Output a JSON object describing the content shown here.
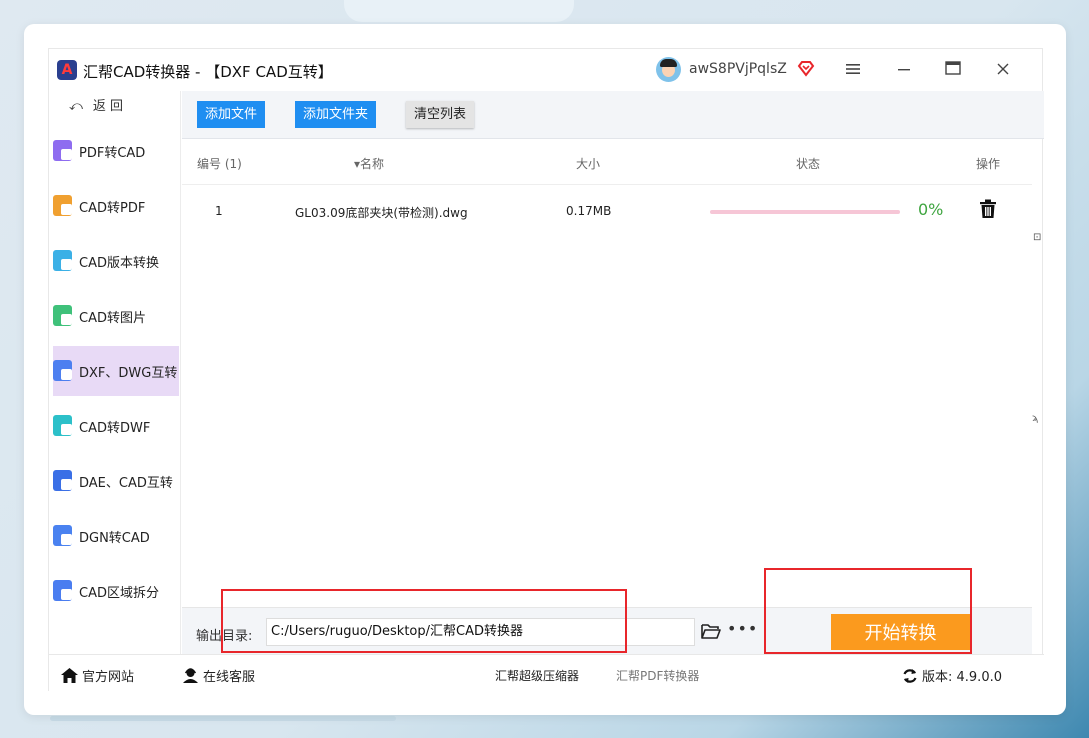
{
  "window": {
    "app_title": "汇帮CAD转换器 - 【DXF CAD互转】",
    "username": "awS8PVjPqlsZ",
    "menu_icon": "menu-icon",
    "minimize_icon": "minimize-icon",
    "maximize_icon": "maximize-icon",
    "close_icon": "close-icon"
  },
  "sidebar": {
    "back_label": "返 回",
    "items": [
      {
        "label": "PDF转CAD",
        "color": "#8e6cf0"
      },
      {
        "label": "CAD转PDF",
        "color": "#f0a030"
      },
      {
        "label": "CAD版本转换",
        "color": "#3bb0e6"
      },
      {
        "label": "CAD转图片",
        "color": "#3fc17a"
      },
      {
        "label": "DXF、DWG互转",
        "color": "#4d7ff0",
        "active": true
      },
      {
        "label": "CAD转DWF",
        "color": "#2cc0c9"
      },
      {
        "label": "DAE、CAD互转",
        "color": "#3a6fe6"
      },
      {
        "label": "DGN转CAD",
        "color": "#4a82f0"
      },
      {
        "label": "CAD区域拆分",
        "color": "#4a7df0"
      }
    ]
  },
  "toolbar": {
    "add_file": "添加文件",
    "add_folder": "添加文件夹",
    "clear_list": "清空列表"
  },
  "table": {
    "headers": {
      "index": "编号 (1)",
      "name": "▾名称",
      "size": "大小",
      "status": "状态",
      "action": "操作"
    },
    "rows": [
      {
        "index": "1",
        "name": "GL03.09底部夹块(带检测).dwg",
        "size": "0.17MB",
        "progress": 0,
        "percent": "0%"
      }
    ]
  },
  "output": {
    "label": "输出目录:",
    "path": "C:/Users/ruguo/Desktop/汇帮CAD转换器",
    "start_button": "开始转换"
  },
  "statusbar": {
    "website": "官方网站",
    "support": "在线客服",
    "link1": "汇帮超级压缩器",
    "link2": "汇帮PDF转换器",
    "version": "版本: 4.9.0.0"
  },
  "colors": {
    "primary_blue": "#1f8ef1",
    "start_orange": "#fb9a1e",
    "progress_green": "#3fa540",
    "active_sidebar": "#e8daf6",
    "highlight_red": "#e8262b"
  }
}
